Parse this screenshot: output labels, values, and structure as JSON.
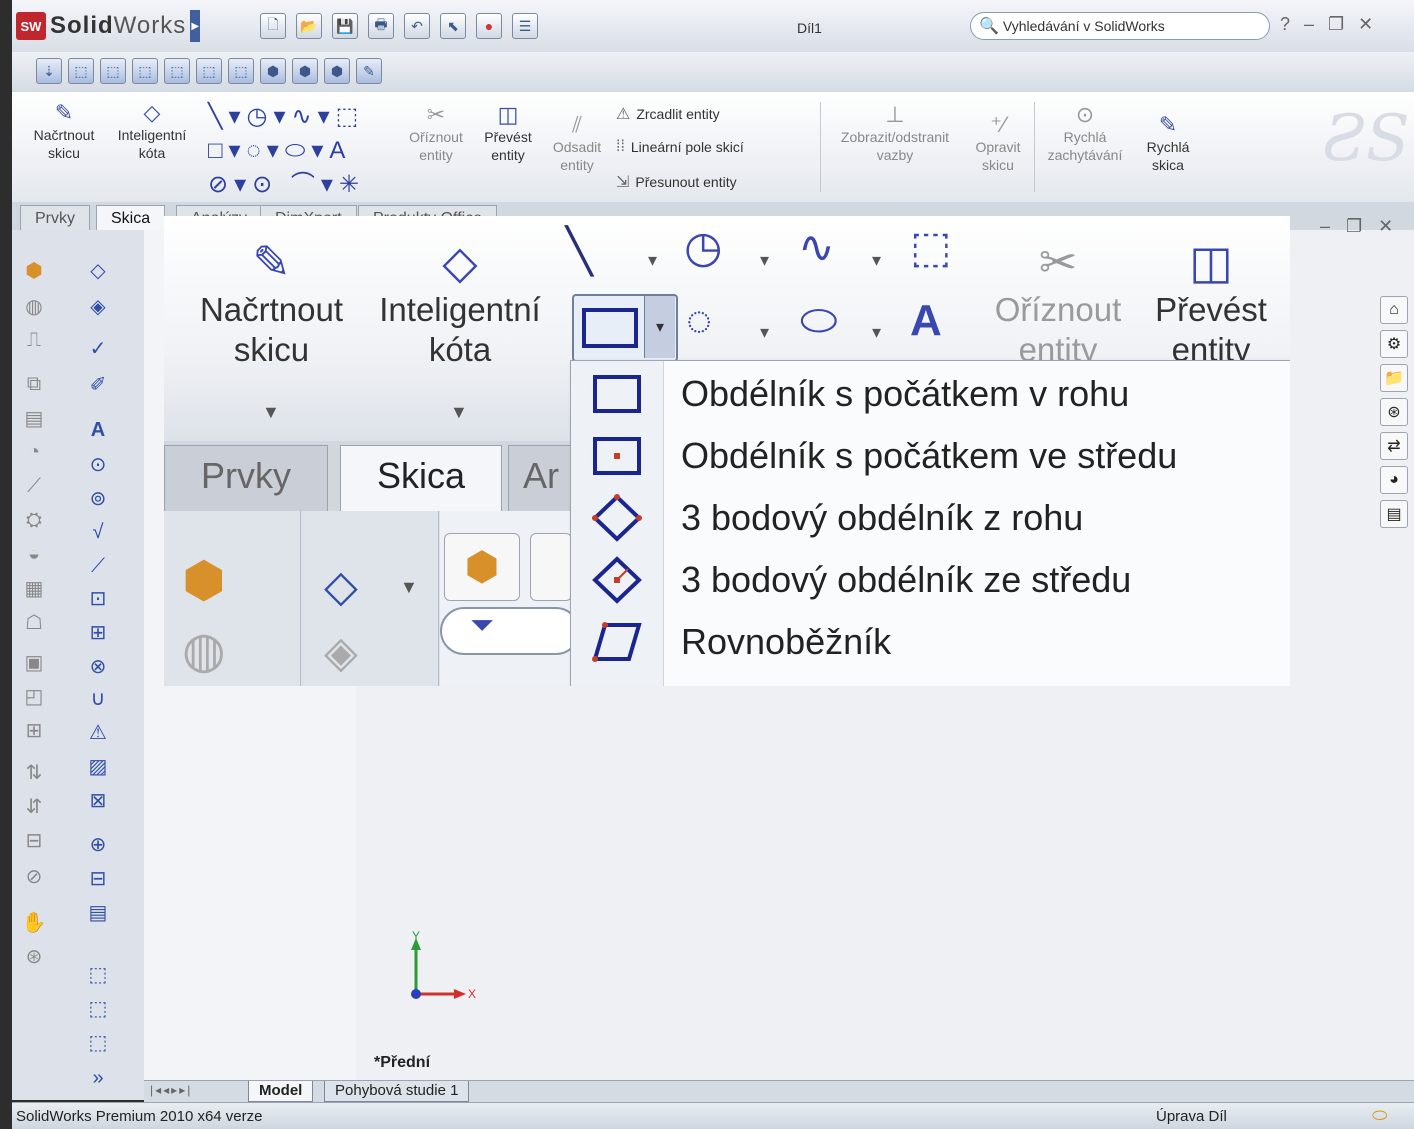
{
  "app": {
    "brand_bold": "Solid",
    "brand_light": "Works",
    "logo_text": "SW",
    "doc_title": "Díl1"
  },
  "search": {
    "placeholder": "Vyhledávání v SolidWorks"
  },
  "help": "?",
  "ribbon": {
    "sketch": "Načrtnout skicu",
    "smart_dim": "Inteligentní kóta",
    "trim": "Oříznout entity",
    "convert": "Převést entity",
    "offset": "Odsadit entity",
    "mirror": "Zrcadlit entity",
    "linear_pattern": "Lineární pole skicí",
    "move": "Přesunout entity",
    "relations": "Zobrazit/odstranit vazby",
    "repair": "Opravit skicu",
    "rapid": "Rychlá zachytávání",
    "quick": "Rychlá skica"
  },
  "tabs": [
    "Prvky",
    "Skica",
    "Analýzy",
    "DimXpert",
    "Produkty Office"
  ],
  "bottom_tabs": [
    "Model",
    "Pohybová studie 1"
  ],
  "view_label": "*Přední",
  "axis": {
    "x": "X",
    "y": "Y"
  },
  "status": {
    "left": "SolidWorks Premium 2010 x64 verze",
    "right": "Úprava Díl"
  },
  "zoom": {
    "sketch_l1": "Načrtnout",
    "sketch_l2": "skicu",
    "dim_l1": "Inteligentní",
    "dim_l2": "kóta",
    "trim_l1": "Oříznout",
    "trim_l2": "entity",
    "convert_l1": "Převést",
    "convert_l2": "entity",
    "tab_prvky": "Prvky",
    "tab_skica": "Skica",
    "tab_next": "Ar"
  },
  "menu": [
    {
      "label": "Obdélník s počátkem v rohu",
      "icon": "corner-rectangle-icon"
    },
    {
      "label": "Obdélník s počátkem ve středu",
      "icon": "center-rectangle-icon"
    },
    {
      "label": "3 bodový obdélník z rohu",
      "icon": "three-point-corner-rectangle-icon"
    },
    {
      "label": "3 bodový obdélník ze středu",
      "icon": "three-point-center-rectangle-icon"
    },
    {
      "label": "Rovnoběžník",
      "icon": "parallelogram-icon"
    }
  ],
  "colors": {
    "accent": "#3b47b0",
    "brand": "#c0262d",
    "axis_x": "#d0302b",
    "axis_y": "#2e9a37"
  }
}
